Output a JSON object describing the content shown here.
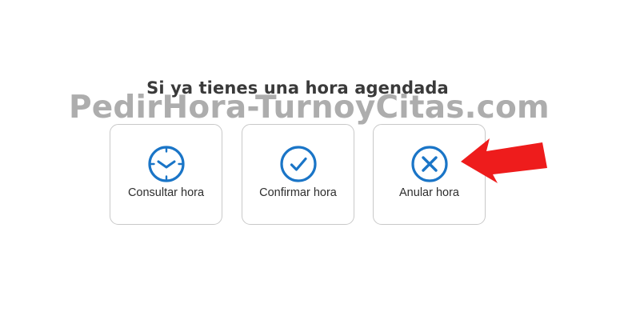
{
  "heading": "Si ya tienes una hora agendada",
  "watermark": "PedirHora-TurnoyCitas.com",
  "cards": [
    {
      "label": "Consultar hora",
      "icon": "clock-icon"
    },
    {
      "label": "Confirmar hora",
      "icon": "check-circle-icon"
    },
    {
      "label": "Anular hora",
      "icon": "x-circle-icon"
    }
  ],
  "annotation": {
    "icon": "red-arrow-pointer",
    "color": "#ee1c1c"
  },
  "colors": {
    "accent": "#1a75c7",
    "card_border": "#c9c9c9",
    "text": "#2e2e2e"
  }
}
